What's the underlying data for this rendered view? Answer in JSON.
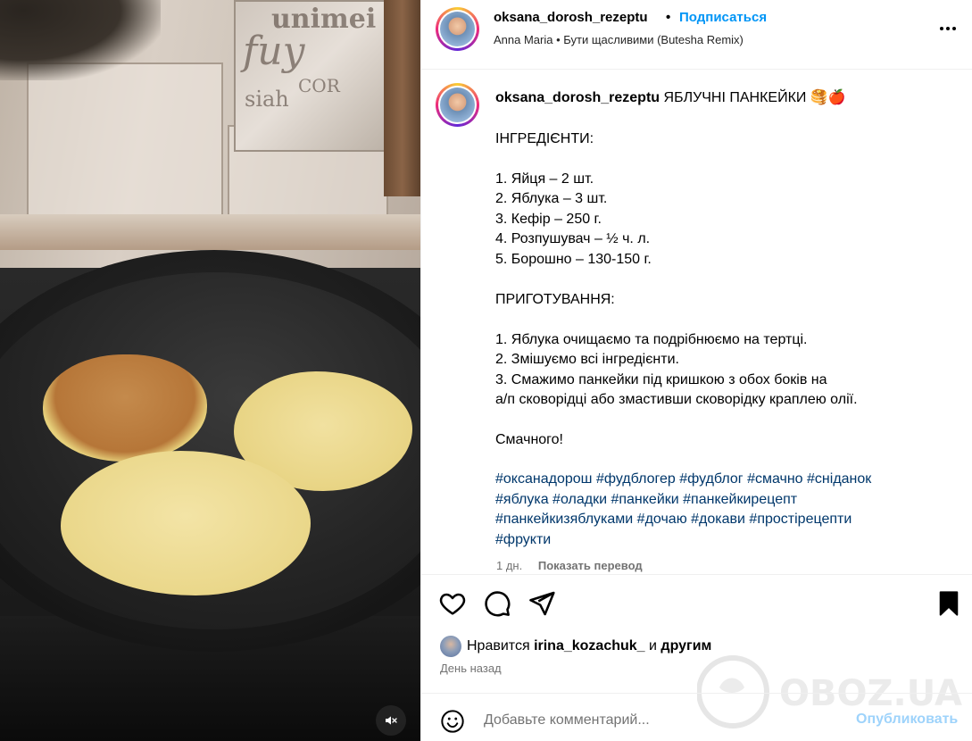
{
  "header": {
    "username": "oksana_dorosh_rezeptu",
    "separator": "•",
    "follow_label": "Подписаться",
    "audio": "Anna Maria • Бути щасливими (Butesha Remix)"
  },
  "caption": {
    "username": "oksana_dorosh_rezeptu",
    "title": "ЯБЛУЧНІ ПАНКЕЙКИ 🥞🍎",
    "ingredients_heading": "ІНГРЕДІЄНТИ:",
    "ingredients": [
      "1. Яйця – 2 шт.",
      "2. Яблука – 3 шт.",
      "3. Кефір – 250 г.",
      "4. Розпушувач – ½ ч. л.",
      "5. Борошно – 130-150 г."
    ],
    "steps_heading": "ПРИГОТУВАННЯ:",
    "steps": [
      "1. Яблука очищаємо та подрібнюємо на тертці.",
      "2. Змішуємо всі інгредієнти.",
      "3. Смажимо панкейки під кришкою з обох боків на",
      "а/п сковорідці або змастивши сковорідку краплею олії."
    ],
    "closing": "Смачного!",
    "hashtag_lines": [
      [
        "#оксанадорош",
        "#фудблогер",
        "#фудблог",
        "#смачно",
        "#сніданок"
      ],
      [
        "#яблука",
        "#оладки",
        "#панкейки",
        "#панкейкирецепт"
      ],
      [
        "#панкейкизяблуками",
        "#дочаю",
        "#докави",
        "#простірецепти"
      ],
      [
        "#фрукти"
      ]
    ],
    "time_ago": "1 дн.",
    "translate_label": "Показать перевод"
  },
  "likes": {
    "prefix": "Нравится",
    "user": "irina_kozachuk_",
    "and": "и",
    "others": "другим"
  },
  "post_date": "День назад",
  "comment": {
    "placeholder": "Добавьте комментарий...",
    "publish_label": "Опубликовать"
  },
  "media_decor_text": [
    "unimei",
    "fuy",
    "COR",
    "siah"
  ],
  "watermark_text": "OBOZ.UA",
  "icons": {
    "like": "heart-icon",
    "comment": "comment-icon",
    "share": "send-icon",
    "save": "bookmark-icon",
    "more": "more-options-icon",
    "emoji": "emoji-icon",
    "mute": "muted-speaker-icon"
  },
  "colors": {
    "link_blue": "#0095f6",
    "hashtag_blue": "#00376b",
    "muted_text": "#737373",
    "publish_disabled": "#9ed3fb"
  }
}
